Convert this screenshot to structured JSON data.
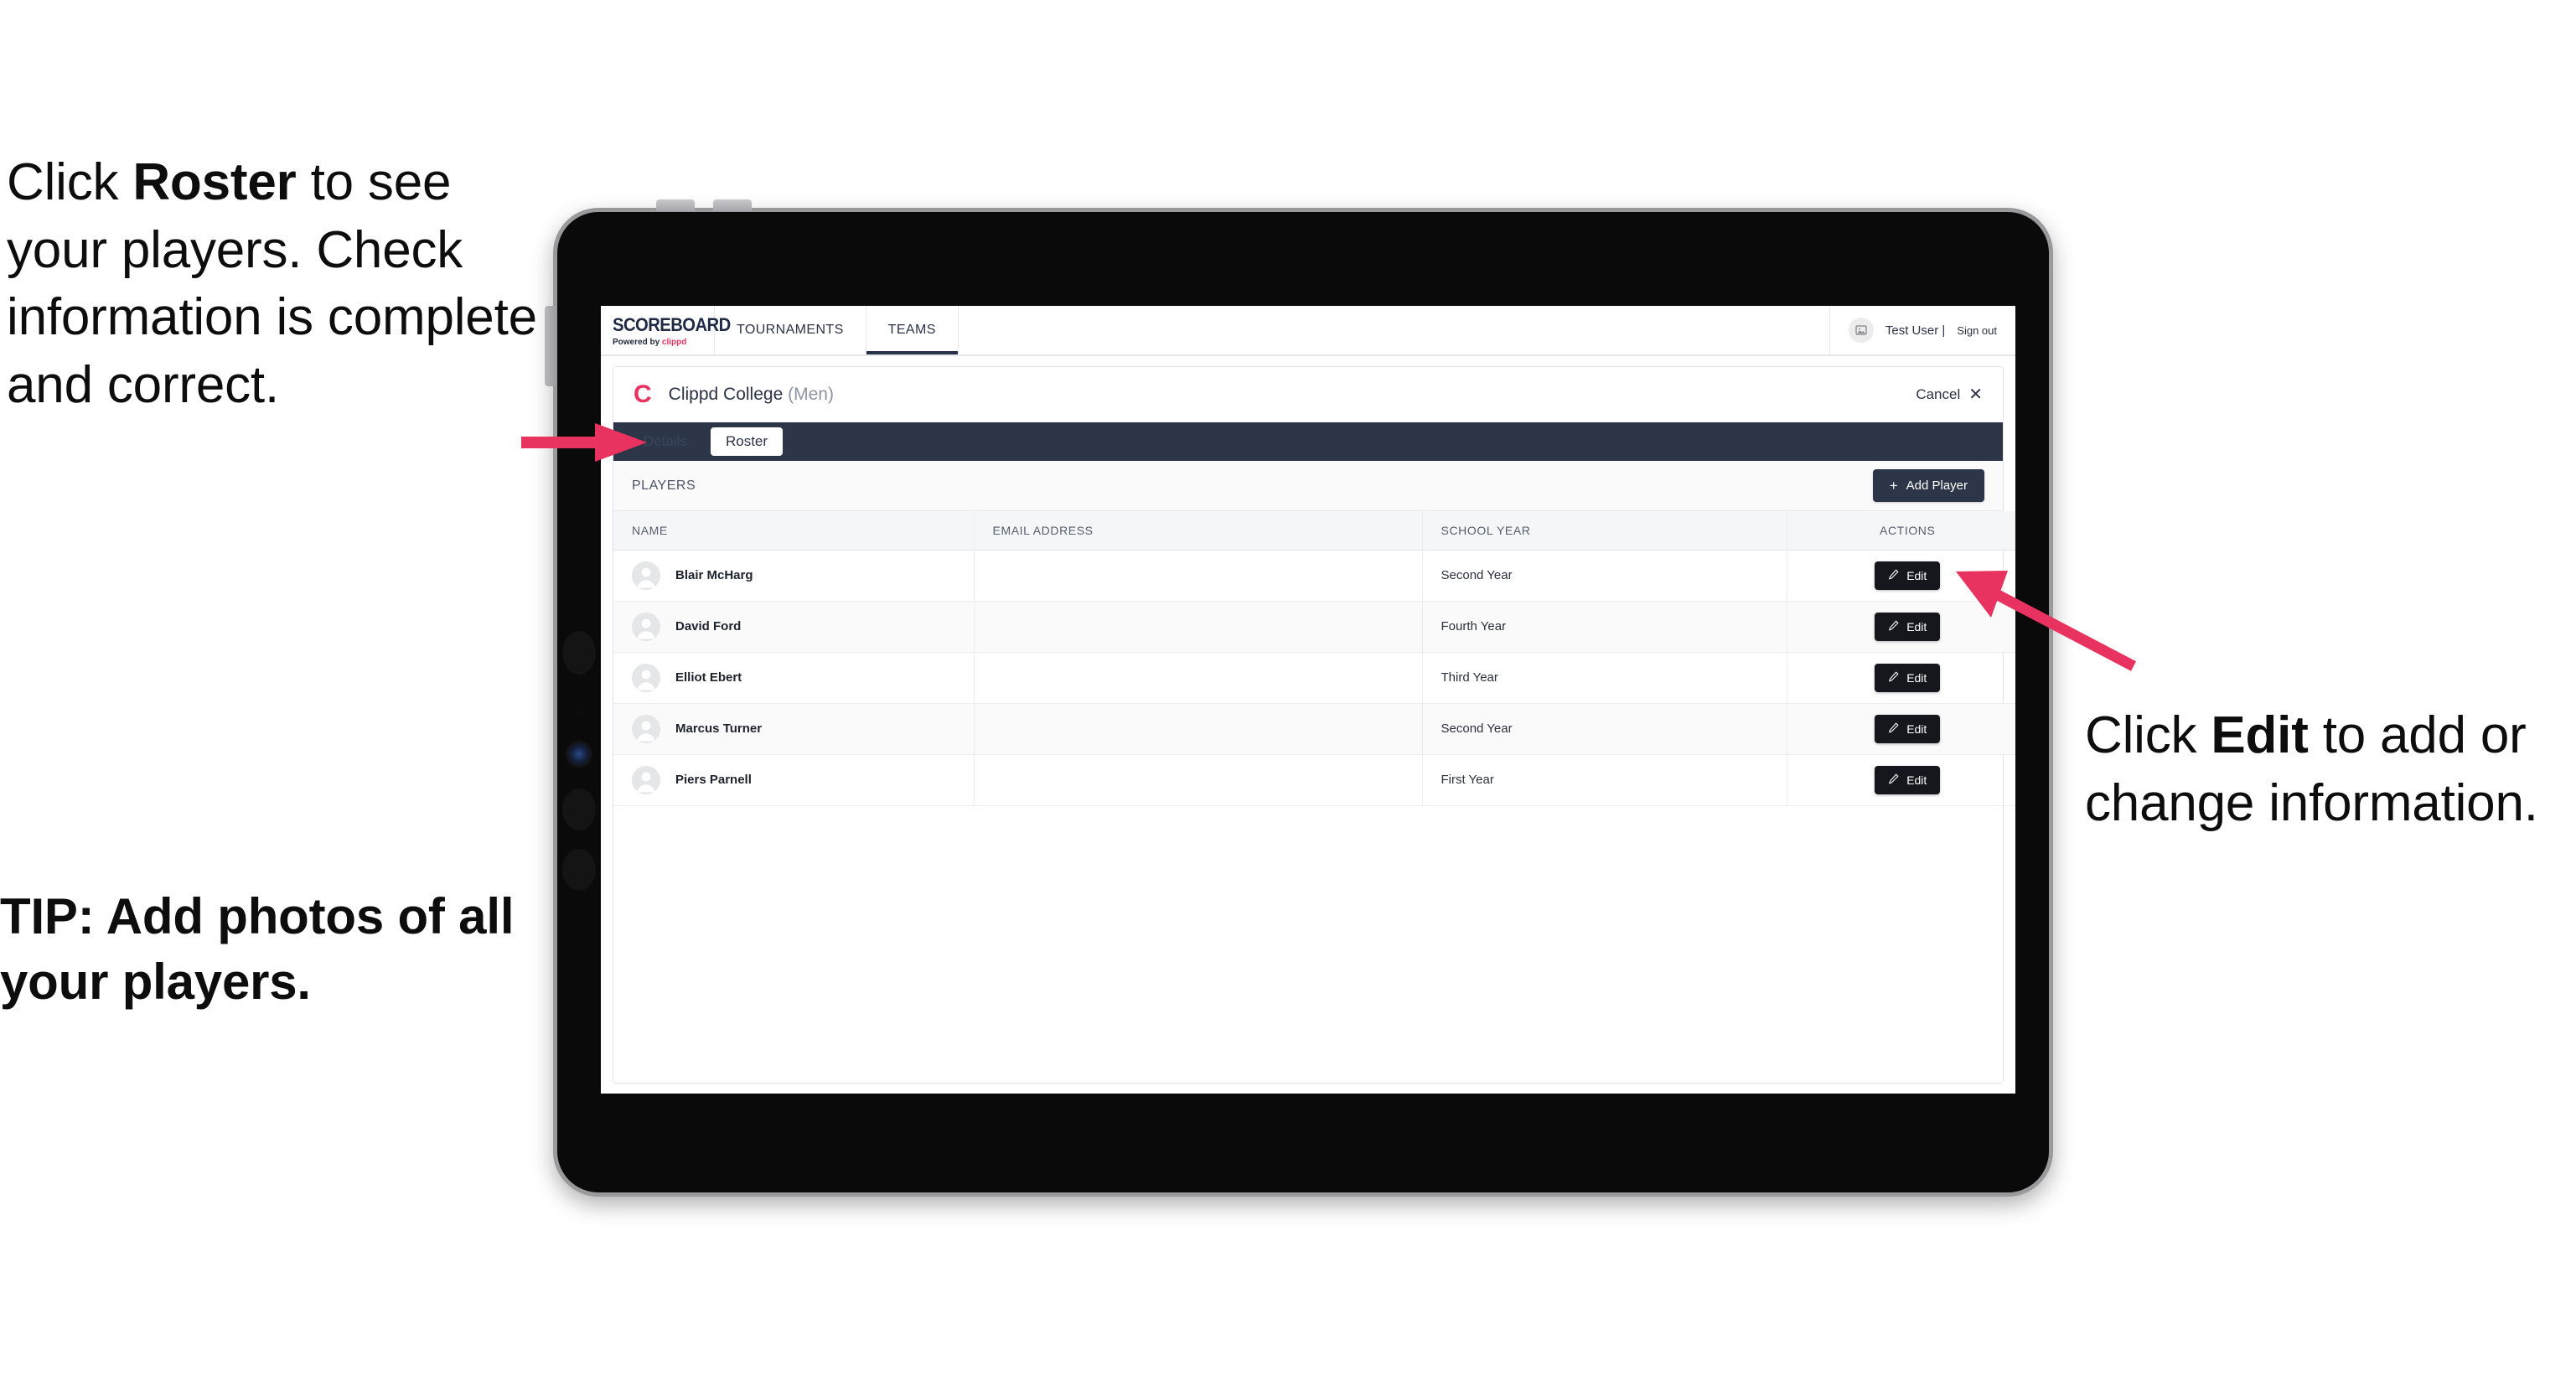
{
  "annotations": {
    "left_top": {
      "pre1": "Click ",
      "bold1": "Roster",
      "post1": " to see your players. Check information is complete and correct."
    },
    "left_tip": "TIP: Add photos of all your players.",
    "right": {
      "pre1": "Click ",
      "bold1": "Edit",
      "post1": " to add or change information."
    }
  },
  "colors": {
    "accent_pink": "#e8325f",
    "navy": "#2c3648",
    "dark_button": "#15171c",
    "bezel": "#0a0a0a",
    "bezel_edge": "#9a9a9d"
  },
  "browser": {
    "topnav": {
      "brand_main": "SCOREBOARD",
      "brand_sub_prefix": "Powered by ",
      "brand_sub_name": "clippd",
      "tabs": [
        {
          "label": "TOURNAMENTS",
          "active": false
        },
        {
          "label": "TEAMS",
          "active": true
        }
      ],
      "avatar_icon": "image-placeholder-icon",
      "user_name": "Test User |",
      "sign_out": "Sign out"
    },
    "page": {
      "team_logo_letter": "C",
      "team_name": "Clippd College",
      "team_gender": "(Men)",
      "cancel_label": "Cancel",
      "close_icon": "close-icon",
      "subtabs": [
        {
          "label": "Details",
          "active": false
        },
        {
          "label": "Roster",
          "active": true
        }
      ],
      "players_label": "PLAYERS",
      "add_player_label": "Add Player",
      "add_player_icon": "plus-icon",
      "table": {
        "columns": [
          "NAME",
          "EMAIL ADDRESS",
          "SCHOOL YEAR",
          "ACTIONS"
        ],
        "edit_label": "Edit",
        "edit_icon": "pencil-icon",
        "rows": [
          {
            "name": "Blair McHarg",
            "email": "",
            "school_year": "Second Year"
          },
          {
            "name": "David Ford",
            "email": "",
            "school_year": "Fourth Year"
          },
          {
            "name": "Elliot Ebert",
            "email": "",
            "school_year": "Third Year"
          },
          {
            "name": "Marcus Turner",
            "email": "",
            "school_year": "Second Year"
          },
          {
            "name": "Piers Parnell",
            "email": "",
            "school_year": "First Year"
          }
        ]
      }
    }
  }
}
